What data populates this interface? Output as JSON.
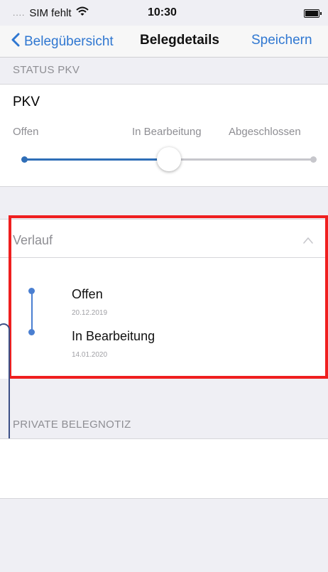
{
  "status_bar": {
    "signal_dots": "....",
    "carrier": "SIM fehlt",
    "wifi_icon": "wifi-icon",
    "time": "10:30",
    "battery_icon": "battery-icon"
  },
  "nav": {
    "back_label": "Belegübersicht",
    "title": "Belegdetails",
    "save_label": "Speichern"
  },
  "status_section": {
    "header": "STATUS PKV",
    "title": "PKV",
    "steps": [
      "Offen",
      "In Bearbeitung",
      "Abgeschlossen"
    ],
    "selected_step": "In Bearbeitung",
    "accent_color": "#2f6eb7"
  },
  "verlauf": {
    "title": "Verlauf",
    "entries": [
      {
        "name": "Offen",
        "date": "20.12.2019"
      },
      {
        "name": "In Bearbeitung",
        "date": "14.01.2020"
      }
    ],
    "highlight_color": "#ef1f1f"
  },
  "notiz_section": {
    "header": "PRIVATE BELEGNOTIZ",
    "value": ""
  }
}
